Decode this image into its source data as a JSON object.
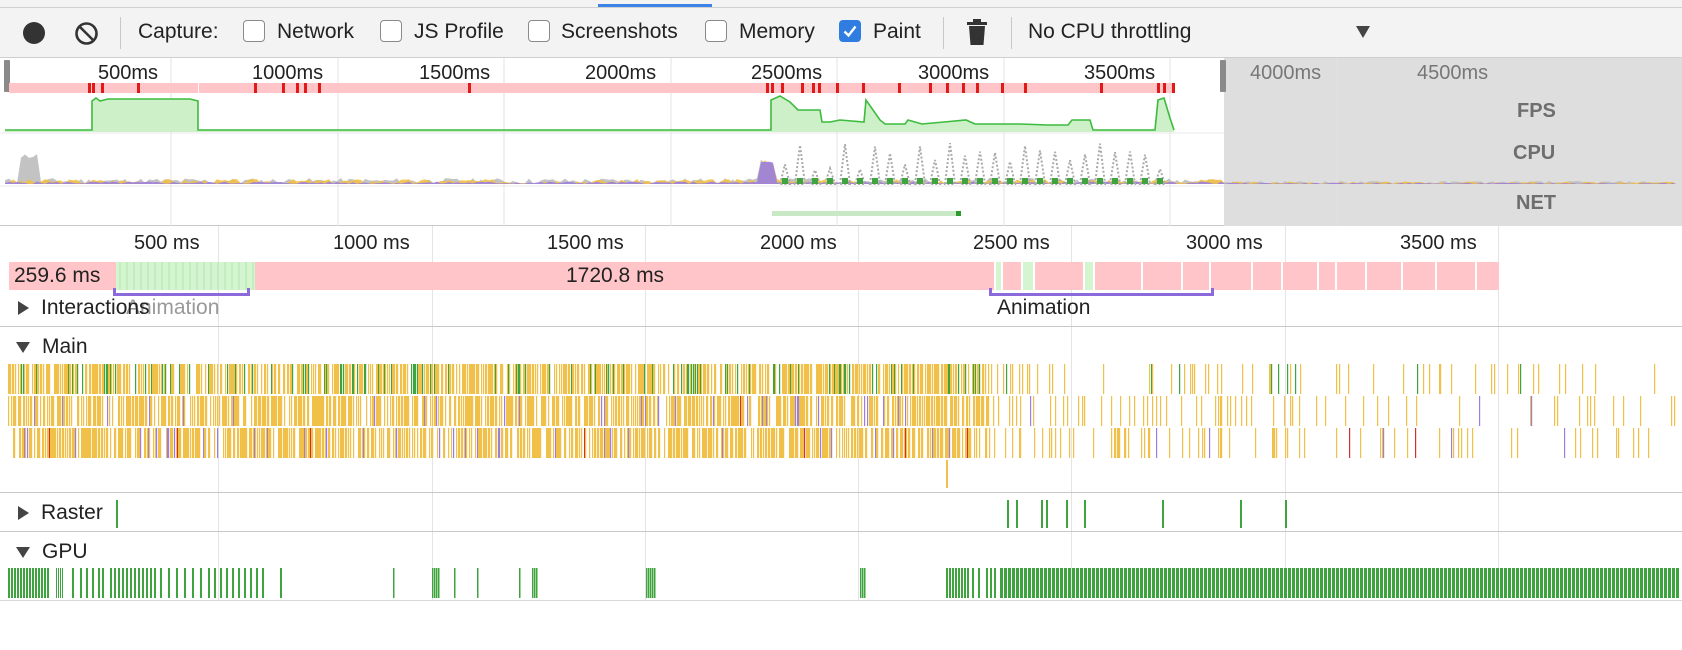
{
  "toolbar": {
    "capture_label": "Capture:",
    "checkboxes": [
      {
        "label": "Network",
        "checked": false
      },
      {
        "label": "JS Profile",
        "checked": false
      },
      {
        "label": "Screenshots",
        "checked": false
      },
      {
        "label": "Memory",
        "checked": false
      },
      {
        "label": "Paint",
        "checked": true
      }
    ],
    "throttling_value": "No CPU throttling",
    "accent_color": "#2f7de1"
  },
  "overview": {
    "ticks": [
      "500ms",
      "1000ms",
      "1500ms",
      "2000ms",
      "2500ms",
      "3000ms",
      "3500ms",
      "4000ms",
      "4500ms"
    ],
    "labels": {
      "fps": "FPS",
      "cpu": "CPU",
      "net": "NET"
    }
  },
  "timeline": {
    "ticks": [
      "500 ms",
      "1000 ms",
      "1500 ms",
      "2000 ms",
      "2500 ms",
      "3000 ms",
      "3500 ms"
    ],
    "frames": {
      "first_frame_duration": "259.6 ms",
      "long_frame_duration": "1720.8 ms"
    },
    "interactions": {
      "label": "Interactions",
      "animation_labels": [
        "Animation",
        "Animation"
      ]
    },
    "tracks": {
      "main": "Main",
      "raster": "Raster",
      "gpu": "GPU"
    }
  },
  "colors": {
    "frame_long": "#ffc5c8",
    "frame_good": "#d3f5cf",
    "fps_line": "#3dbb3d",
    "scripting": "#f0c048",
    "rendering": "#9b7fe0",
    "painting": "#3fa43f",
    "animation_bracket": "#8b6adb"
  }
}
